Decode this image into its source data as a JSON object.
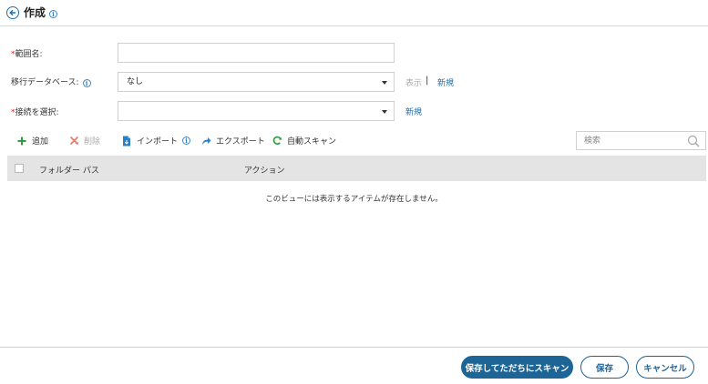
{
  "header": {
    "title": "作成"
  },
  "form": {
    "scope_name": {
      "required_mark": "*",
      "label": "範囲名:",
      "value": ""
    },
    "migration_db": {
      "label": "移行データベース:",
      "selected": "なし",
      "view_label": "表示",
      "separator": "|",
      "new_label": "新規"
    },
    "connection": {
      "required_mark": "*",
      "label": "接続を選択:",
      "selected": "",
      "new_label": "新規"
    }
  },
  "toolbar": {
    "add": "追加",
    "delete": "削除",
    "import": "インポート",
    "export": "エクスポート",
    "autoscan": "自動スキャン",
    "search_placeholder": "検索"
  },
  "table": {
    "columns": [
      "フォルダー パス",
      "アクション"
    ],
    "empty_message": "このビューには表示するアイテムが存在しません。"
  },
  "footer": {
    "save_scan": "保存してただちにスキャン",
    "save": "保存",
    "cancel": "キャンセル"
  },
  "colors": {
    "primary": "#1d6497",
    "link": "#1e6fb0",
    "required": "#d9282f",
    "add_icon": "#2e9c3e",
    "delete_icon": "#e27a6e",
    "autoscan_icon": "#2e9c3e"
  },
  "icons": {
    "back": "back-arrow-icon",
    "info": "info-icon",
    "add": "plus-icon",
    "delete": "delete-icon",
    "import": "import-file-icon",
    "export": "share-arrow-icon",
    "autoscan": "refresh-icon",
    "search": "magnifier-icon"
  }
}
